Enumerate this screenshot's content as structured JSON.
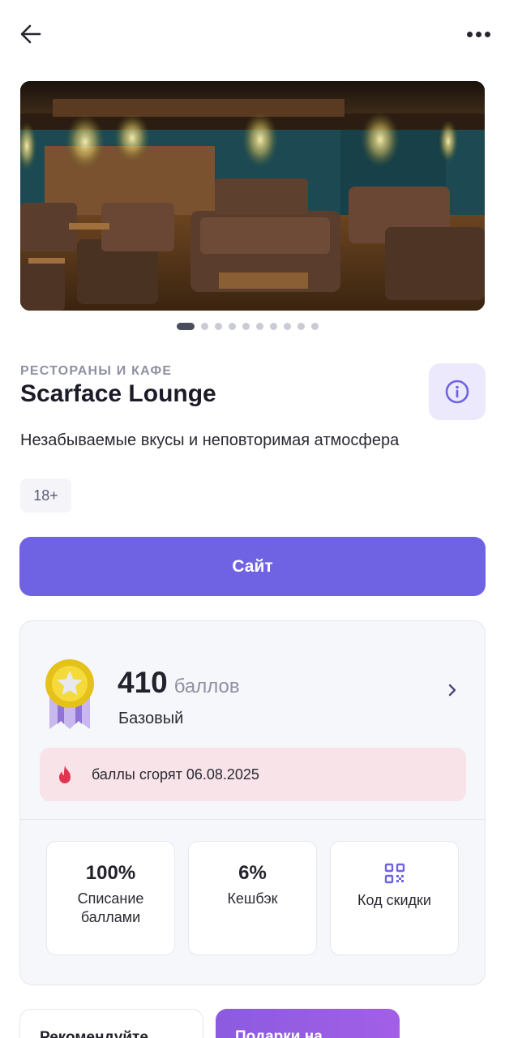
{
  "header": {
    "back_icon": "arrow-left-icon",
    "more_icon": "more-horizontal-icon"
  },
  "gallery": {
    "slides_count": 11,
    "active_index": 0
  },
  "place": {
    "category": "РЕСТОРАНЫ И КАФЕ",
    "name": "Scarface Lounge",
    "description": "Незабываемые вкусы и неповторимая атмосфера",
    "age_rating": "18+",
    "info_icon": "info-icon"
  },
  "actions": {
    "site_label": "Сайт"
  },
  "loyalty": {
    "points": "410",
    "points_unit": "баллов",
    "level": "Базовый",
    "expire_text": "баллы сгорят 06.08.2025",
    "tiles": [
      {
        "value": "100%",
        "label": "Списание баллами"
      },
      {
        "value": "6%",
        "label": "Кешбэк"
      },
      {
        "icon": "qr-code-icon",
        "label": "Код скидки"
      }
    ]
  },
  "bottom_cards": {
    "recommend": "Рекомендуйте",
    "gift": "Подарки на"
  },
  "colors": {
    "accent": "#6f63e3",
    "expire_bg": "#f8e3e8",
    "fire": "#e0344f",
    "muted": "#8e90a3"
  }
}
